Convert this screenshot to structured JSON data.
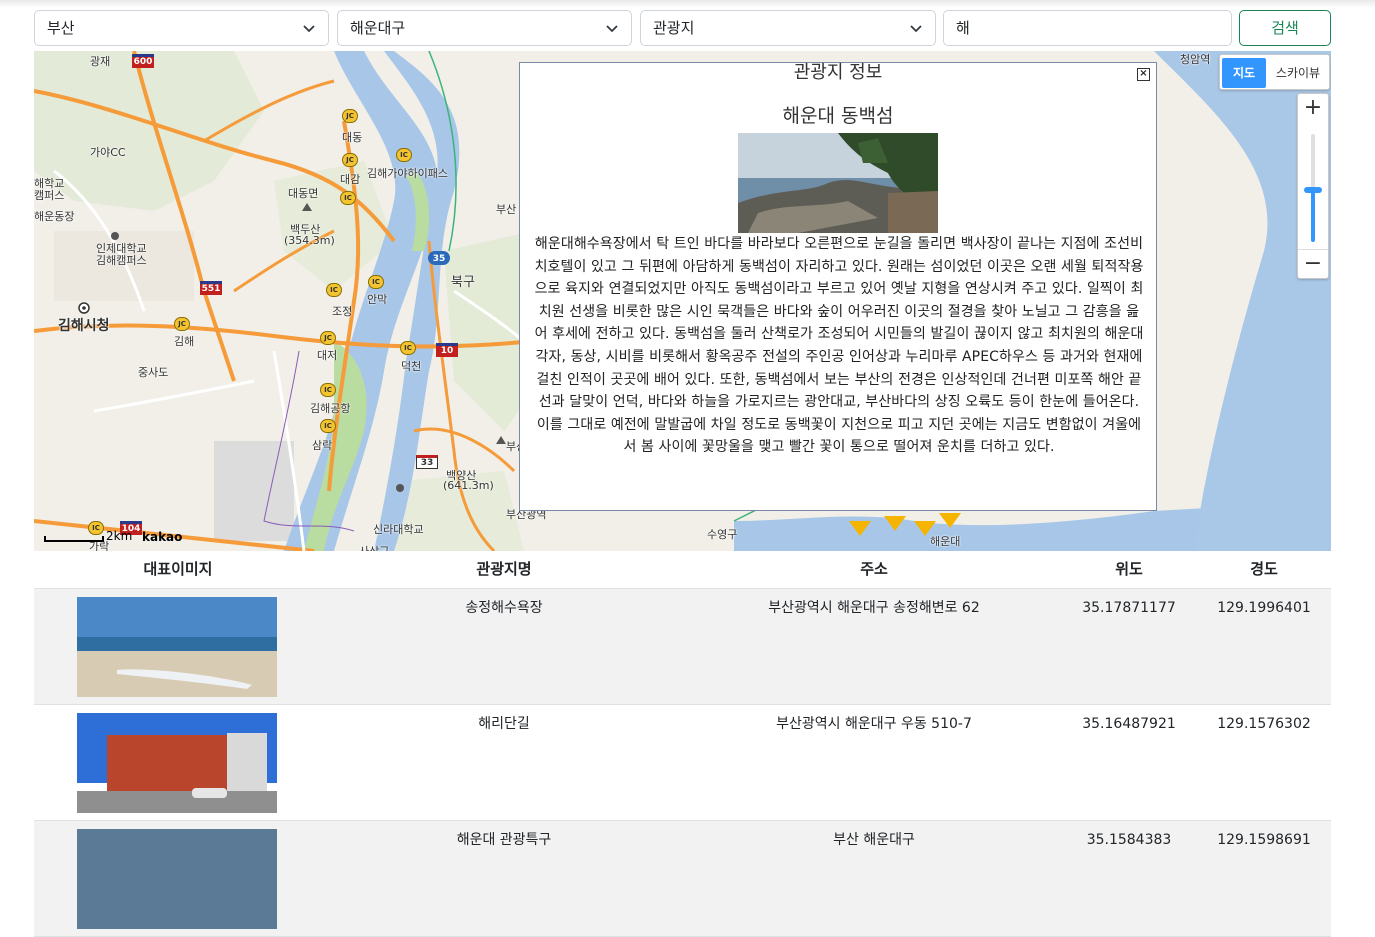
{
  "search": {
    "region": "부산",
    "district": "해운대구",
    "category": "관광지",
    "keyword": "해",
    "button_label": "검색"
  },
  "map": {
    "maptype_map": "지도",
    "maptype_sky": "스카이뷰",
    "zoom_in": "+",
    "zoom_out": "−",
    "scale": "2km",
    "brand": "kakao",
    "labels": [
      "광재",
      "가야CC",
      "해학교",
      "캠퍼스",
      "해운동장",
      "인제대학교",
      "김해캠퍼스",
      "김해시청",
      "대동면",
      "백두산",
      "(354.3m)",
      "대동",
      "대감",
      "김해가야하이패스",
      "조정",
      "안막",
      "김해",
      "대저",
      "중사도",
      "김해공항",
      "삼락",
      "덕천",
      "북구",
      "백양산",
      "(641.3m)",
      "신라대학교",
      "부산광역",
      "수영구",
      "해운대",
      "부산진구",
      "사상구",
      "가락",
      "청암역",
      "부산"
    ],
    "highway_numbers": [
      "600",
      "551",
      "35",
      "10",
      "33",
      "104"
    ]
  },
  "popup": {
    "header": "관광지 정보",
    "close": "×",
    "name": "해운대 동백섬",
    "description": "해운대해수욕장에서 탁 트인 바다를 바라보다 오른편으로 눈길을 돌리면 백사장이 끝나는 지점에 조선비치호텔이 있고 그 뒤편에 아담하게 동백섬이 자리하고 있다. 원래는 섬이었던 이곳은 오랜 세월 퇴적작용으로 육지와 연결되었지만 아직도 동백섬이라고 부르고 있어 옛날 지형을 연상시켜 주고 있다. 일찍이 최치원 선생을 비롯한 많은 시인 묵객들은 바다와 숲이 어우러진 이곳의 절경을 찾아 노닐고 그 감흥을 읊어 후세에 전하고 있다. 동백섬을 둘러 산책로가 조성되어 시민들의 발길이 끊이지 않고 최치원의 해운대 각자, 동상, 시비를 비롯해서 황옥공주 전설의 주인공 인어상과 누리마루 APEC하우스 등 과거와 현재에 걸친 인적이 곳곳에 배어 있다. 또한, 동백섬에서 보는 부산의 전경은 인상적인데 건너편 미포쪽 해안 끝선과 달맞이 언덕, 바다와 하늘을 가로지르는 광안대교, 부산바다의 상징 오륙도 등이 한눈에 들어온다. 이를 그대로 예전에 말발굽에 차일 정도로 동백꽃이 지천으로 피고 지던 곳에는 지금도 변함없이 겨울에서 봄 사이에 꽃망울을 맺고 빨간 꽃이 통으로 떨어져 운치를 더하고 있다."
  },
  "table": {
    "headers": [
      "대표이미지",
      "관광지명",
      "주소",
      "위도",
      "경도"
    ],
    "rows": [
      {
        "name": "송정해수욕장",
        "address": "부산광역시 해운대구 송정해변로 62",
        "lat": "35.17871177",
        "lng": "129.1996401"
      },
      {
        "name": "해리단길",
        "address": "부산광역시 해운대구 우동 510-7",
        "lat": "35.16487921",
        "lng": "129.1576302"
      },
      {
        "name": "해운대 관광특구",
        "address": "부산 해운대구",
        "lat": "35.1584383",
        "lng": "129.1598691"
      }
    ]
  },
  "colors": {
    "accent": "#198754",
    "map_active": "#3396ff",
    "river": "#a7c6e8",
    "highway": "#f59b3a"
  }
}
